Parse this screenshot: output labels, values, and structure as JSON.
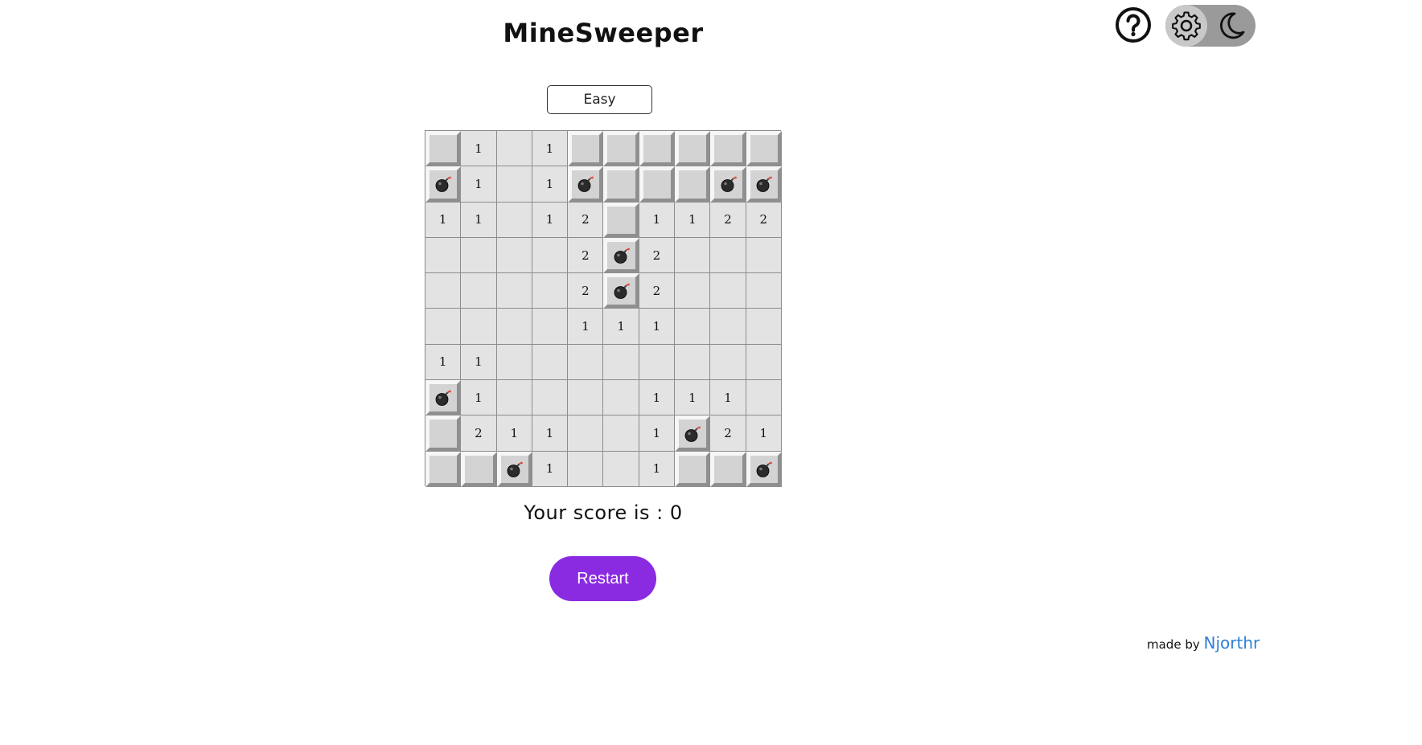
{
  "header": {
    "title": "MineSweeper"
  },
  "controls": {
    "help_icon": "question-circle-icon",
    "settings_icon": "gear-icon",
    "theme_icon": "moon-icon"
  },
  "difficulty": {
    "selected": "Easy"
  },
  "board": {
    "rows": [
      [
        {
          "s": "c",
          "v": ""
        },
        {
          "s": "o",
          "v": "1"
        },
        {
          "s": "o",
          "v": ""
        },
        {
          "s": "o",
          "v": "1"
        },
        {
          "s": "c",
          "v": ""
        },
        {
          "s": "c",
          "v": ""
        },
        {
          "s": "c",
          "v": ""
        },
        {
          "s": "c",
          "v": ""
        },
        {
          "s": "c",
          "v": ""
        },
        {
          "s": "c",
          "v": ""
        }
      ],
      [
        {
          "s": "b",
          "v": ""
        },
        {
          "s": "o",
          "v": "1"
        },
        {
          "s": "o",
          "v": ""
        },
        {
          "s": "o",
          "v": "1"
        },
        {
          "s": "b",
          "v": ""
        },
        {
          "s": "c",
          "v": ""
        },
        {
          "s": "c",
          "v": ""
        },
        {
          "s": "c",
          "v": ""
        },
        {
          "s": "b",
          "v": ""
        },
        {
          "s": "b",
          "v": ""
        }
      ],
      [
        {
          "s": "o",
          "v": "1"
        },
        {
          "s": "o",
          "v": "1"
        },
        {
          "s": "o",
          "v": ""
        },
        {
          "s": "o",
          "v": "1"
        },
        {
          "s": "o",
          "v": "2"
        },
        {
          "s": "c",
          "v": ""
        },
        {
          "s": "o",
          "v": "1"
        },
        {
          "s": "o",
          "v": "1"
        },
        {
          "s": "o",
          "v": "2"
        },
        {
          "s": "o",
          "v": "2"
        }
      ],
      [
        {
          "s": "o",
          "v": ""
        },
        {
          "s": "o",
          "v": ""
        },
        {
          "s": "o",
          "v": ""
        },
        {
          "s": "o",
          "v": ""
        },
        {
          "s": "o",
          "v": "2"
        },
        {
          "s": "b",
          "v": ""
        },
        {
          "s": "o",
          "v": "2"
        },
        {
          "s": "o",
          "v": ""
        },
        {
          "s": "o",
          "v": ""
        },
        {
          "s": "o",
          "v": ""
        }
      ],
      [
        {
          "s": "o",
          "v": ""
        },
        {
          "s": "o",
          "v": ""
        },
        {
          "s": "o",
          "v": ""
        },
        {
          "s": "o",
          "v": ""
        },
        {
          "s": "o",
          "v": "2"
        },
        {
          "s": "b",
          "v": ""
        },
        {
          "s": "o",
          "v": "2"
        },
        {
          "s": "o",
          "v": ""
        },
        {
          "s": "o",
          "v": ""
        },
        {
          "s": "o",
          "v": ""
        }
      ],
      [
        {
          "s": "o",
          "v": ""
        },
        {
          "s": "o",
          "v": ""
        },
        {
          "s": "o",
          "v": ""
        },
        {
          "s": "o",
          "v": ""
        },
        {
          "s": "o",
          "v": "1"
        },
        {
          "s": "o",
          "v": "1"
        },
        {
          "s": "o",
          "v": "1"
        },
        {
          "s": "o",
          "v": ""
        },
        {
          "s": "o",
          "v": ""
        },
        {
          "s": "o",
          "v": ""
        }
      ],
      [
        {
          "s": "o",
          "v": "1"
        },
        {
          "s": "o",
          "v": "1"
        },
        {
          "s": "o",
          "v": ""
        },
        {
          "s": "o",
          "v": ""
        },
        {
          "s": "o",
          "v": ""
        },
        {
          "s": "o",
          "v": ""
        },
        {
          "s": "o",
          "v": ""
        },
        {
          "s": "o",
          "v": ""
        },
        {
          "s": "o",
          "v": ""
        },
        {
          "s": "o",
          "v": ""
        }
      ],
      [
        {
          "s": "b",
          "v": ""
        },
        {
          "s": "o",
          "v": "1"
        },
        {
          "s": "o",
          "v": ""
        },
        {
          "s": "o",
          "v": ""
        },
        {
          "s": "o",
          "v": ""
        },
        {
          "s": "o",
          "v": ""
        },
        {
          "s": "o",
          "v": "1"
        },
        {
          "s": "o",
          "v": "1"
        },
        {
          "s": "o",
          "v": "1"
        },
        {
          "s": "o",
          "v": ""
        }
      ],
      [
        {
          "s": "c",
          "v": ""
        },
        {
          "s": "o",
          "v": "2"
        },
        {
          "s": "o",
          "v": "1"
        },
        {
          "s": "o",
          "v": "1"
        },
        {
          "s": "o",
          "v": ""
        },
        {
          "s": "o",
          "v": ""
        },
        {
          "s": "o",
          "v": "1"
        },
        {
          "s": "b",
          "v": ""
        },
        {
          "s": "o",
          "v": "2"
        },
        {
          "s": "o",
          "v": "1"
        }
      ],
      [
        {
          "s": "c",
          "v": ""
        },
        {
          "s": "c",
          "v": ""
        },
        {
          "s": "b",
          "v": ""
        },
        {
          "s": "o",
          "v": "1"
        },
        {
          "s": "o",
          "v": ""
        },
        {
          "s": "o",
          "v": ""
        },
        {
          "s": "o",
          "v": "1"
        },
        {
          "s": "c",
          "v": ""
        },
        {
          "s": "c",
          "v": ""
        },
        {
          "s": "b",
          "v": ""
        }
      ]
    ]
  },
  "score": {
    "text": "Your score is : 0"
  },
  "restart": {
    "label": "Restart"
  },
  "footer": {
    "prefix": "made by ",
    "author": "Njorthr"
  },
  "colors": {
    "accent": "#8a2be2",
    "link": "#2f7fd6",
    "toggle_bg": "#9a9a9a"
  }
}
